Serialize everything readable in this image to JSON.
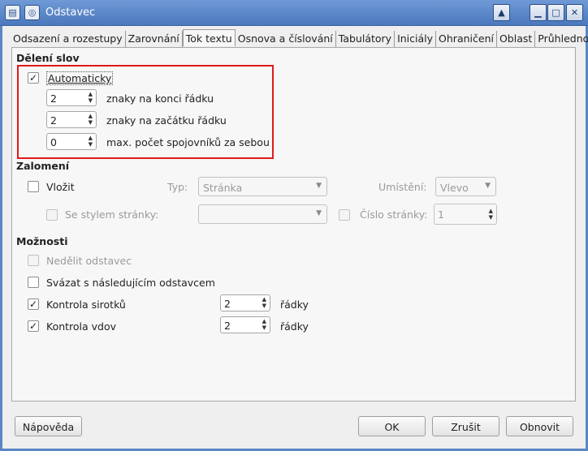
{
  "window": {
    "title": "Odstavec",
    "app_icon": "document-icon",
    "pin_icon": "pin-icon",
    "controls": {
      "up": "▲",
      "minimize": "▁",
      "maximize": "□",
      "close": "✕"
    }
  },
  "tabs": [
    {
      "label": "Odsazení a rozestupy"
    },
    {
      "label": "Zarovnání"
    },
    {
      "label": "Tok textu",
      "active": true
    },
    {
      "label": "Osnova a číslování"
    },
    {
      "label": "Tabulátory"
    },
    {
      "label": "Iniciály"
    },
    {
      "label": "Ohraničení"
    },
    {
      "label": "Oblast"
    },
    {
      "label": "Průhlednost"
    }
  ],
  "hyphenation": {
    "title": "Dělení slov",
    "auto": {
      "label": "Automaticky",
      "checked": true
    },
    "end_chars": {
      "value": "2",
      "label": "znaky na konci řádku"
    },
    "start_chars": {
      "value": "2",
      "label": "znaky na začátku řádku"
    },
    "max_hyphens": {
      "value": "0",
      "label": "max. počet spojovníků za sebou"
    }
  },
  "breaks": {
    "title": "Zalomení",
    "insert": {
      "label": "Vložit",
      "checked": false
    },
    "type": {
      "label": "Typ:",
      "value": "Stránka"
    },
    "position": {
      "label": "Umístění:",
      "value": "Vlevo"
    },
    "with_style": {
      "label": "Se stylem stránky:",
      "checked": false,
      "value": ""
    },
    "page_number": {
      "label": "Číslo stránky:",
      "checked": false,
      "value": "1"
    }
  },
  "options": {
    "title": "Možnosti",
    "no_split": {
      "label": "Nedělit odstavec",
      "checked": false
    },
    "keep_next": {
      "label": "Svázat s následujícím odstavcem",
      "checked": false
    },
    "orphan": {
      "label": "Kontrola sirotků",
      "checked": true,
      "value": "2",
      "unit": "řádky"
    },
    "widow": {
      "label": "Kontrola vdov",
      "checked": true,
      "value": "2",
      "unit": "řádky"
    }
  },
  "buttons": {
    "help": "Nápověda",
    "ok": "OK",
    "cancel": "Zrušit",
    "reset": "Obnovit"
  },
  "glyphs": {
    "check": "✓",
    "spin_up": "▲",
    "spin_down": "▼",
    "chevron": "▼"
  },
  "colors": {
    "highlight": "#e01a1a",
    "titlebar": "#5a87c4"
  }
}
